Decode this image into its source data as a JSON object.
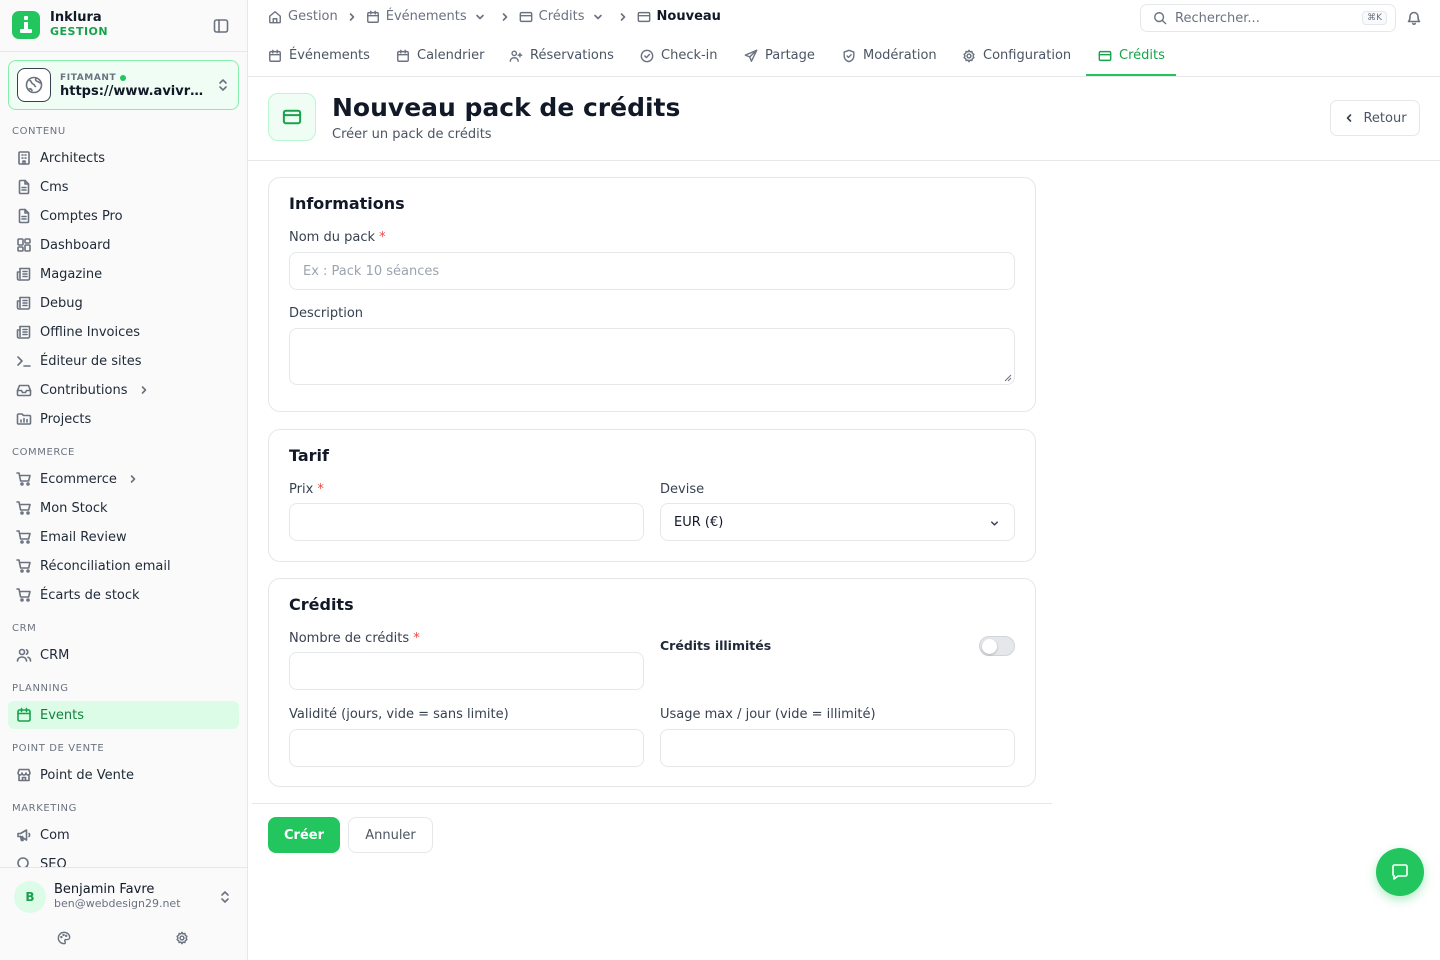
{
  "brand": {
    "name": "Inklura",
    "sub": "GESTION"
  },
  "workspace": {
    "label": "FITAMANT",
    "url": "https://www.avivre-fitness.fr"
  },
  "sidebar": {
    "sections": [
      {
        "label": "CONTENU"
      },
      {
        "label": "COMMERCE"
      },
      {
        "label": "CRM"
      },
      {
        "label": "PLANNING"
      },
      {
        "label": "POINT DE VENTE"
      },
      {
        "label": "MARKETING"
      }
    ],
    "items": [
      {
        "label": "Architects",
        "icon": "building-icon"
      },
      {
        "label": "Cms",
        "icon": "file-icon"
      },
      {
        "label": "Comptes Pro",
        "icon": "file-icon"
      },
      {
        "label": "Dashboard",
        "icon": "grid-icon"
      },
      {
        "label": "Magazine",
        "icon": "newspaper-icon"
      },
      {
        "label": "Debug",
        "icon": "newspaper-icon"
      },
      {
        "label": "Offline Invoices",
        "icon": "newspaper-icon"
      },
      {
        "label": "Éditeur de sites",
        "icon": "terminal-icon"
      },
      {
        "label": "Contributions",
        "icon": "inbox-icon"
      },
      {
        "label": "Projects",
        "icon": "folder-chart-icon"
      },
      {
        "label": "Ecommerce",
        "icon": "cart-icon"
      },
      {
        "label": "Mon Stock",
        "icon": "cart-icon"
      },
      {
        "label": "Email Review",
        "icon": "cart-icon"
      },
      {
        "label": "Réconciliation email",
        "icon": "cart-icon"
      },
      {
        "label": "Écarts de stock",
        "icon": "cart-icon"
      },
      {
        "label": "CRM",
        "icon": "users-icon"
      },
      {
        "label": "Events",
        "icon": "calendar-icon"
      },
      {
        "label": "Point de Vente",
        "icon": "store-icon"
      },
      {
        "label": "Com",
        "icon": "megaphone-icon"
      },
      {
        "label": "SEO",
        "icon": "search-icon"
      }
    ]
  },
  "user": {
    "initial": "B",
    "name": "Benjamin Favre",
    "email": "ben@webdesign29.net"
  },
  "breadcrumb": [
    "Gestion",
    "Événements",
    "Crédits",
    "Nouveau"
  ],
  "search": {
    "placeholder": "Rechercher...",
    "shortcut": "⌘K"
  },
  "tabs": [
    {
      "label": "Événements"
    },
    {
      "label": "Calendrier"
    },
    {
      "label": "Réservations"
    },
    {
      "label": "Check-in"
    },
    {
      "label": "Partage"
    },
    {
      "label": "Modération"
    },
    {
      "label": "Configuration"
    },
    {
      "label": "Crédits",
      "active": true
    }
  ],
  "page": {
    "title": "Nouveau pack de crédits",
    "subtitle": "Créer un pack de crédits",
    "back_label": "Retour"
  },
  "form": {
    "informations": {
      "title": "Informations",
      "name_label": "Nom du pack",
      "name_placeholder": "Ex : Pack 10 séances",
      "description_label": "Description"
    },
    "tarif": {
      "title": "Tarif",
      "price_label": "Prix",
      "currency_label": "Devise",
      "currency_value": "EUR (€)"
    },
    "credits": {
      "title": "Crédits",
      "count_label": "Nombre de crédits",
      "unlimited_label": "Crédits illimités",
      "unlimited_on": false,
      "validity_label": "Validité (jours, vide = sans limite)",
      "usage_label": "Usage max / jour (vide = illimité)"
    },
    "required_marker": "*"
  },
  "actions": {
    "submit_label": "Créer",
    "cancel_label": "Annuler"
  },
  "colors": {
    "accent": "#22c55e",
    "accent_dark": "#16a34a",
    "active_bg": "#dcfce7",
    "required": "#ef4444"
  }
}
